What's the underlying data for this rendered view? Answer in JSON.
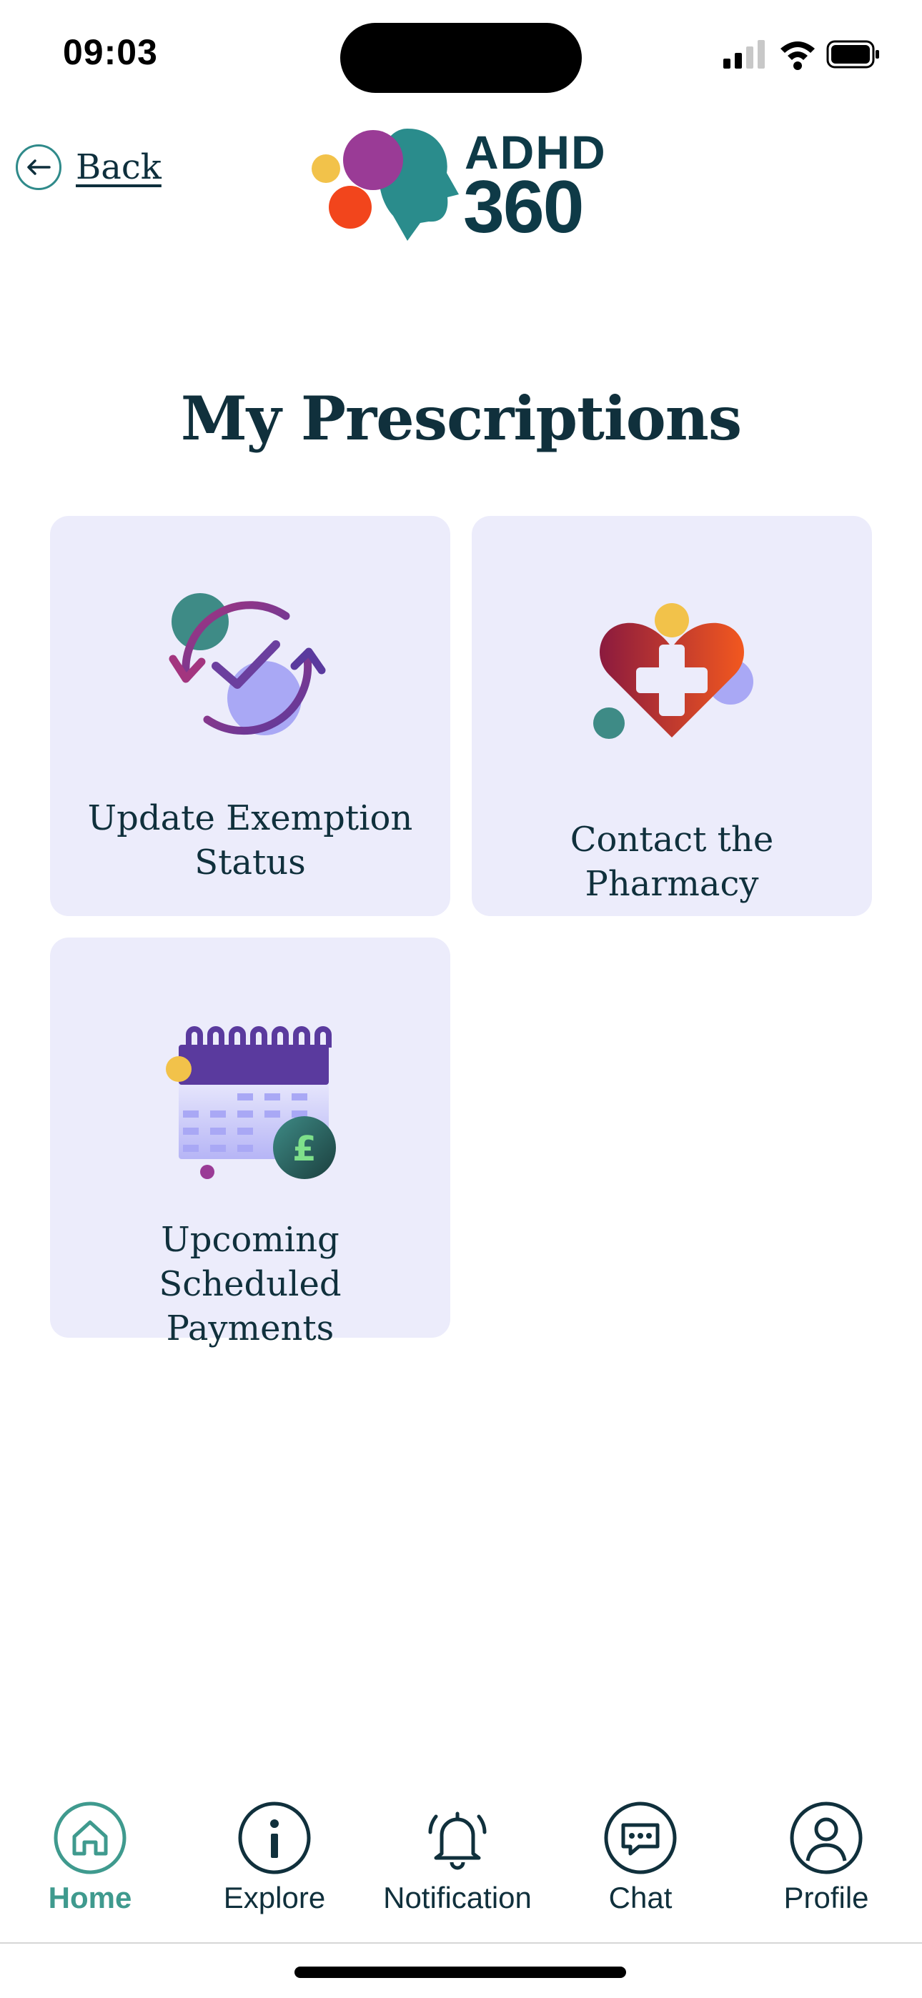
{
  "status_bar": {
    "time": "09:03"
  },
  "header": {
    "back_label": "Back",
    "logo_top": "ADHD",
    "logo_bottom": "360"
  },
  "page": {
    "title": "My Prescriptions"
  },
  "tiles": [
    {
      "label": "Update Exemption Status",
      "icon": "exemption-refresh-check-icon"
    },
    {
      "label": "Contact the Pharmacy",
      "icon": "pharmacy-heart-icon"
    },
    {
      "label": "Upcoming Scheduled Payments",
      "icon": "calendar-payment-icon"
    }
  ],
  "nav": {
    "items": [
      {
        "label": "Home",
        "icon": "home-icon",
        "active": true
      },
      {
        "label": "Explore",
        "icon": "info-icon",
        "active": false
      },
      {
        "label": "Notification",
        "icon": "bell-icon",
        "active": false
      },
      {
        "label": "Chat",
        "icon": "chat-icon",
        "active": false
      },
      {
        "label": "Profile",
        "icon": "user-icon",
        "active": false
      }
    ]
  },
  "colors": {
    "tile_bg": "#ececfb",
    "text_dark": "#10303c",
    "accent_teal": "#3f9a8e",
    "logo_navy": "#0e3a47"
  }
}
